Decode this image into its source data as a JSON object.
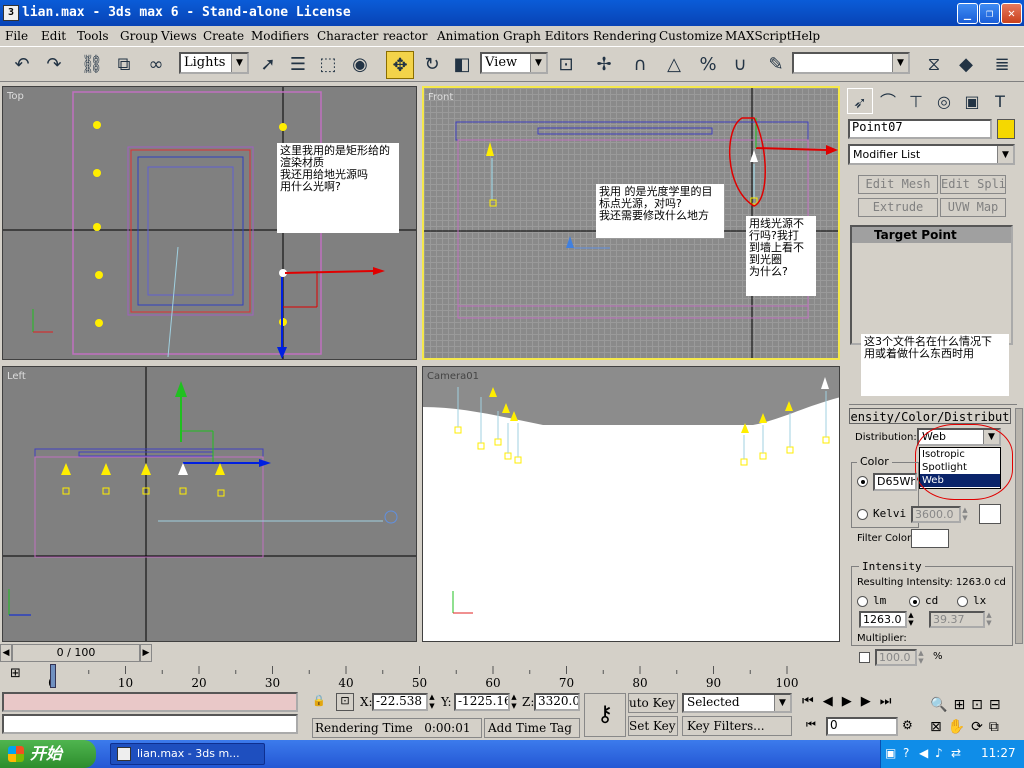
{
  "window": {
    "title": "lian.max - 3ds max 6 - Stand-alone License",
    "icon": "3ds-max-app-icon"
  },
  "menu": [
    "File",
    "Edit",
    "Tools",
    "Group",
    "Views",
    "Create",
    "Modifiers",
    "Character",
    "reactor",
    "Animation",
    "Graph Editors",
    "Rendering",
    "Customize",
    "MAXScript",
    "Help"
  ],
  "toolbar": {
    "selection_filter": "Lights",
    "ref_coord": "View",
    "named_selection": ""
  },
  "viewports": {
    "top": {
      "label": "Top"
    },
    "front": {
      "label": "Front"
    },
    "left": {
      "label": "Left"
    },
    "camera": {
      "label": "Camera01"
    }
  },
  "notes": {
    "top_note": [
      "这里我用的是矩形给的",
      "渲染材质",
      "我还用给地光源吗",
      "用什么光啊?"
    ],
    "front_note1": [
      "我用 的是光度学里的目",
      "标点光源，对吗?",
      "我还需要修改什么地方"
    ],
    "front_note2": [
      "用线光源不",
      "行吗?我打",
      "到墙上看不",
      "到光圈",
      "为什么?"
    ],
    "panel_note": [
      "这3个文件名在什么情况下",
      "用或着做什么东西时用"
    ]
  },
  "cmdpanel": {
    "object_name": "Point07",
    "object_color": "#f5d800",
    "modifier_list": "Modifier List",
    "buttons": [
      "Edit Mesh",
      "Edit Spline",
      "Extrude",
      "UVW Map"
    ],
    "stack_item": "Target Point",
    "rollout_title": "ensity/Color/Distribut",
    "distribution_label": "Distribution:",
    "distribution_value": "Web",
    "distribution_options": [
      "Isotropic",
      "Spotlight",
      "Web"
    ],
    "color_group": "Color",
    "color_preset": "D65Wh",
    "kelvin_label": "Kelvi",
    "kelvin_value": "3600.0",
    "filter_label": "Filter Color:",
    "intensity_group": "Intensity",
    "resulting_intensity": "Resulting Intensity: 1263.0 cd",
    "units": [
      "lm",
      "cd",
      "lx"
    ],
    "intensity_value": "1263.0",
    "intensity_value2": "39.37",
    "multiplier_label": "Multiplier:",
    "multiplier_value": "100.0",
    "percent": "%"
  },
  "timeline": {
    "frame": "0 / 100",
    "ticks": [
      "0",
      "10",
      "20",
      "30",
      "40",
      "50",
      "60",
      "70",
      "80",
      "90",
      "100"
    ]
  },
  "status": {
    "x_label": "X:",
    "x_value": "-22.538",
    "y_label": "Y:",
    "y_value": "-1225.16",
    "z_label": "Z:",
    "z_value": "3320.0",
    "auto_key": "uto Key",
    "set_key": "Set Key",
    "key_mode": "Selected",
    "key_filters": "Key Filters...",
    "frame_field": "0",
    "rendering_time_label": "Rendering Time",
    "rendering_time_value": "0:00:01",
    "add_time_tag": "Add Time Tag"
  },
  "taskbar": {
    "start": "开始",
    "task": "lian.max - 3ds m...",
    "clock": "11:27"
  }
}
